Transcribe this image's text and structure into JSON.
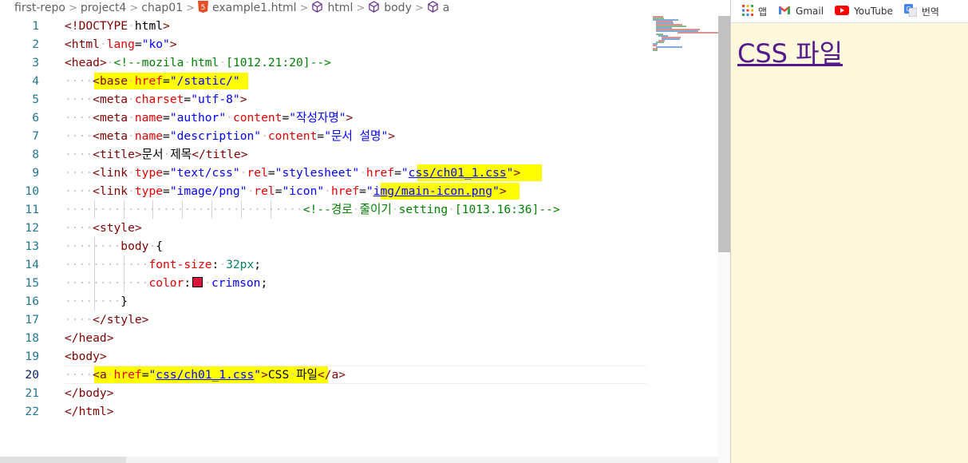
{
  "breadcrumb": {
    "items": [
      "first-repo",
      "project4",
      "chap01",
      "example1.html",
      "html",
      "body",
      "a"
    ],
    "separator": ">"
  },
  "editor": {
    "active_line": 20,
    "lines": [
      "<!DOCTYPE html>",
      "<html lang=\"ko\">",
      "<head> <!--mozila html [1012.21:20]-->",
      "    <base href=\"/static/\"",
      "    <meta charset=\"utf-8\">",
      "    <meta name=\"author\" content=\"작성자명\">",
      "    <meta name=\"description\" content=\"문서 설명\">",
      "    <title>문서 제목</title>",
      "    <link type=\"text/css\" rel=\"stylesheet\" href=\"css/ch01_1.css\">",
      "    <link type=\"image/png\" rel=\"icon\" href=\"img/main-icon.png\">",
      "                                  <!--경로 줄이기 setting [1013.16:36]-->",
      "    <style>",
      "        body {",
      "            font-size: 32px;",
      "            color: crimson;",
      "        }",
      "    </style>",
      "</head>",
      "<body>",
      "    <a href=\"css/ch01_1.css\">CSS 파일</a>",
      "</body>",
      "</html>"
    ]
  },
  "colors": {
    "crimson_swatch": "#dc143c",
    "highlight": "#ffff00",
    "browser_bg": "#fff8dc",
    "link": "#551a8b"
  },
  "bookmarks": [
    {
      "label": "앱",
      "icon": "apps-grid-icon"
    },
    {
      "label": "Gmail",
      "icon": "gmail-icon"
    },
    {
      "label": "YouTube",
      "icon": "youtube-icon"
    },
    {
      "label": "번역",
      "icon": "translate-icon"
    }
  ],
  "preview": {
    "link_text": "CSS 파일"
  }
}
